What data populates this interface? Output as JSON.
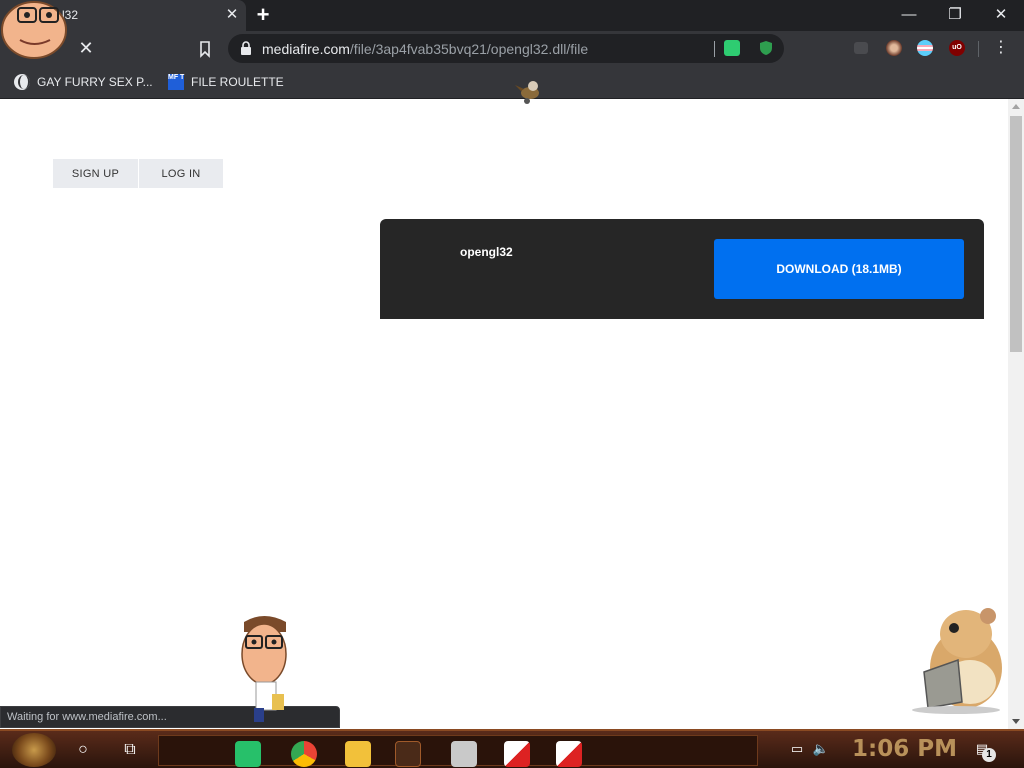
{
  "tab": {
    "title": "l32",
    "close_glyph": "✕"
  },
  "new_tab_glyph": "+",
  "window_controls": {
    "minimize": "—",
    "restore": "❐",
    "close": "✕"
  },
  "toolbar": {
    "back_glyph": "←",
    "stop_glyph": "✕",
    "url_host": "mediafire.com",
    "url_path": "/file/3ap4fvab35bvq21/opengl32.dll/file",
    "menu_glyph": "⋮"
  },
  "bookmarks": [
    {
      "label": "GAY FURRY SEX P...",
      "icon": "globe-icon"
    },
    {
      "label": "FILE ROULETTE",
      "icon": "mf-icon",
      "icon_text": "MF T"
    }
  ],
  "auth": {
    "sign_up": "SIGN UP",
    "log_in": "LOG IN"
  },
  "download": {
    "file_name": "opengl32",
    "button_label": "DOWNLOAD (18.1MB)"
  },
  "status_text": "Waiting for www.mediafire.com...",
  "taskbar": {
    "cortana_glyph": "○",
    "taskview_glyph": "⧉",
    "clock": "1:06 PM",
    "notifications_count": "1"
  },
  "colors": {
    "download_button": "#0070f0",
    "card_bg": "#262626",
    "chrome_dark": "#202124",
    "chrome_toolbar": "#35363a"
  }
}
